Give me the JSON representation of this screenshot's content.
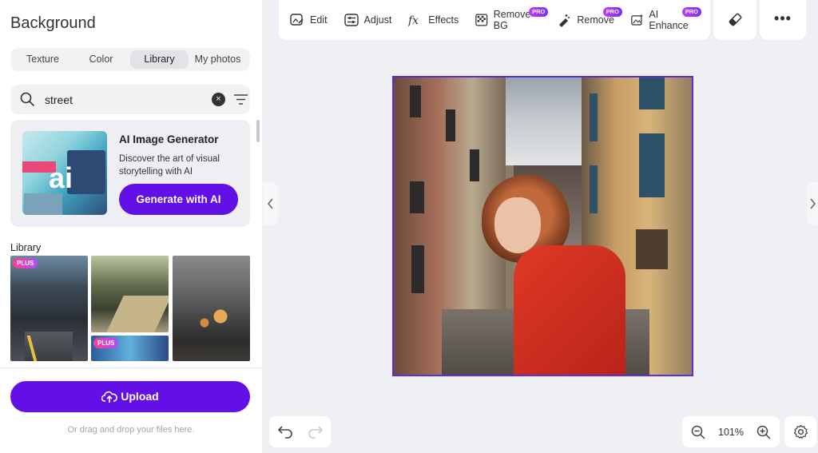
{
  "panel": {
    "title": "Background",
    "tabs": [
      {
        "label": "Texture",
        "active": false
      },
      {
        "label": "Color",
        "active": false
      },
      {
        "label": "Library",
        "active": true
      },
      {
        "label": "My photos",
        "active": false
      }
    ],
    "search": {
      "value": "street"
    },
    "ai_card": {
      "thumb_text": "ai",
      "title": "AI Image Generator",
      "description": "Discover the art of visual storytelling with AI",
      "button": "Generate with AI"
    },
    "library_label": "Library",
    "badges": {
      "plus": "PLUS"
    },
    "upload_button": "Upload",
    "drag_hint": "Or drag and drop your files here."
  },
  "toolbar": {
    "items": [
      {
        "label": "Edit",
        "icon": "edit-image-icon",
        "pro": false
      },
      {
        "label": "Adjust",
        "icon": "sliders-icon",
        "pro": false
      },
      {
        "label": "Effects",
        "icon": "fx-icon",
        "pro": false
      },
      {
        "label": "Remove BG",
        "icon": "remove-bg-icon",
        "pro": true
      },
      {
        "label": "Remove",
        "icon": "magic-eraser-icon",
        "pro": true
      },
      {
        "label": "AI Enhance",
        "icon": "ai-enhance-icon",
        "pro": true
      }
    ],
    "pro_badge": "PRO",
    "more": "•••"
  },
  "zoom": {
    "value": "101%"
  },
  "colors": {
    "accent": "#6210e6",
    "canvas_border": "#5b2ee0",
    "pro_badge": "#b33bff",
    "plus_badge": "#ff3d8f"
  }
}
